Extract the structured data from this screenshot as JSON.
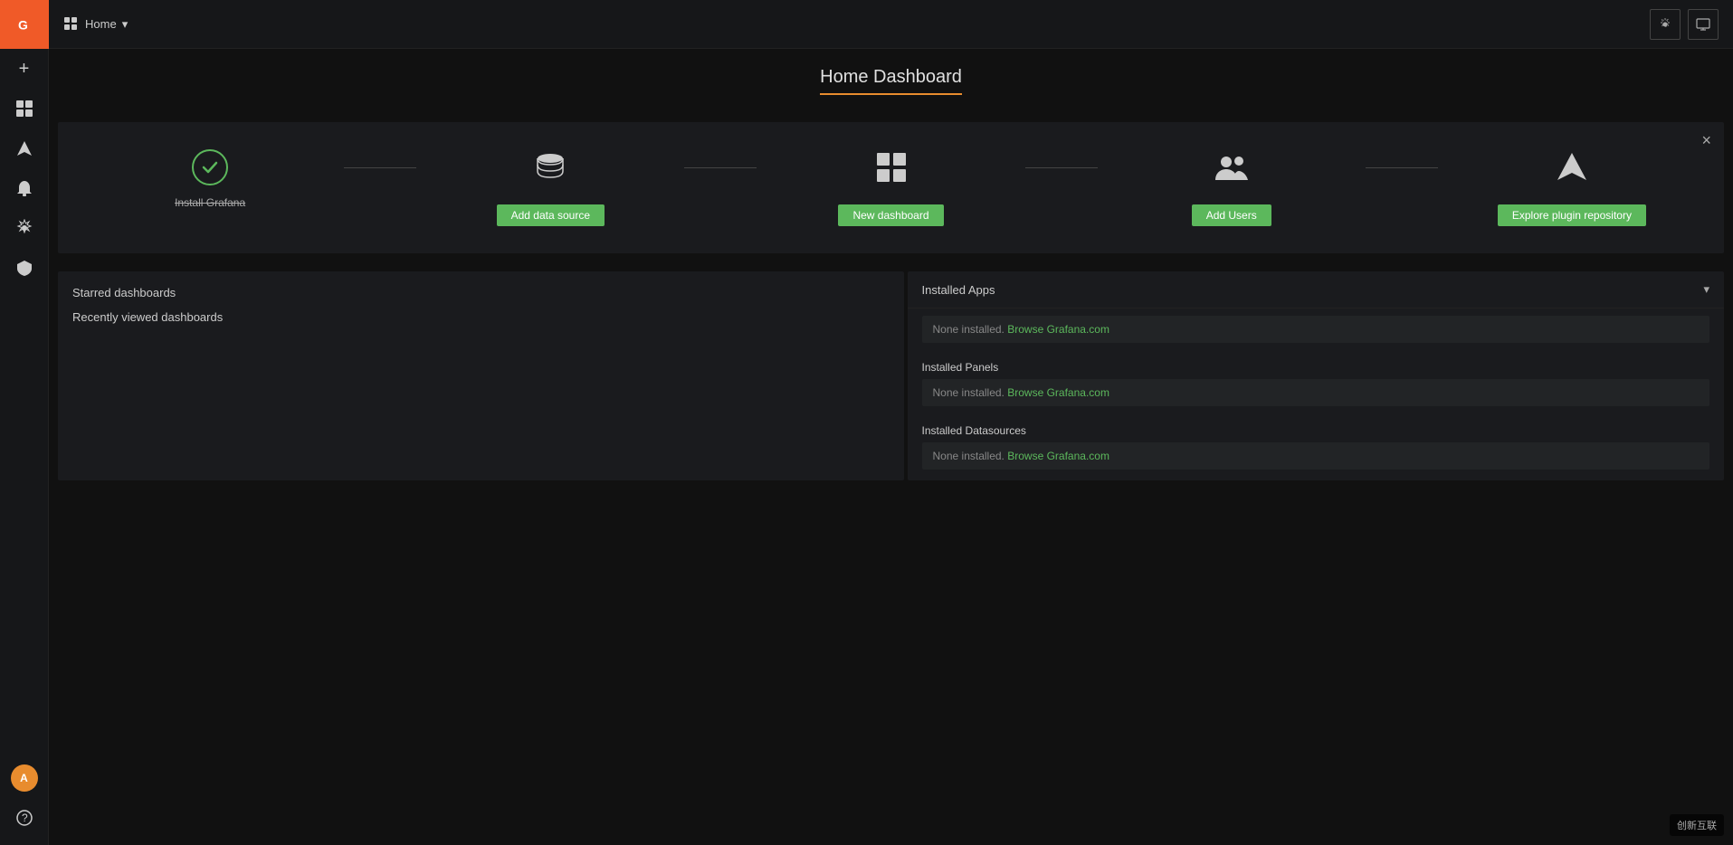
{
  "app": {
    "name": "Grafana"
  },
  "topnav": {
    "home_label": "Home",
    "dropdown_icon": "▾",
    "settings_icon": "⚙",
    "monitor_icon": "🖥"
  },
  "page": {
    "title": "Home Dashboard"
  },
  "getting_started": {
    "close_icon": "×",
    "steps": [
      {
        "id": "install-grafana",
        "icon_type": "check",
        "label": "Install Grafana",
        "is_done": true,
        "button_label": null
      },
      {
        "id": "add-data-source",
        "icon_type": "database",
        "label": null,
        "is_done": false,
        "button_label": "Add data source"
      },
      {
        "id": "new-dashboard",
        "icon_type": "dashboard",
        "label": null,
        "is_done": false,
        "button_label": "New dashboard"
      },
      {
        "id": "add-users",
        "icon_type": "users",
        "label": null,
        "is_done": false,
        "button_label": "Add Users"
      },
      {
        "id": "explore-plugins",
        "icon_type": "plugins",
        "label": null,
        "is_done": false,
        "button_label": "Explore plugin repository"
      }
    ]
  },
  "left_panel": {
    "starred_label": "Starred dashboards",
    "recent_label": "Recently viewed dashboards"
  },
  "right_panel": {
    "installed_apps": {
      "title": "Installed Apps",
      "none_installed_text": "None installed.",
      "browse_link_text": "Browse Grafana.com"
    },
    "installed_panels": {
      "title": "Installed Panels",
      "none_installed_text": "None installed.",
      "browse_link_text": "Browse Grafana.com"
    },
    "installed_datasources": {
      "title": "Installed Datasources",
      "none_installed_text": "None installed.",
      "browse_link_text": "Browse Grafana.com"
    }
  },
  "sidebar": {
    "items": [
      {
        "id": "add",
        "icon": "+",
        "label": "Create"
      },
      {
        "id": "dashboards",
        "icon": "⊞",
        "label": "Dashboards"
      },
      {
        "id": "explore",
        "icon": "✦",
        "label": "Explore"
      },
      {
        "id": "alerting",
        "icon": "🔔",
        "label": "Alerting"
      },
      {
        "id": "settings",
        "icon": "⚙",
        "label": "Configuration"
      },
      {
        "id": "shield",
        "icon": "🛡",
        "label": "Server Admin"
      }
    ],
    "bottom": {
      "avatar_initials": "A",
      "help_icon": "?"
    }
  },
  "watermark": {
    "text": "创新互联"
  }
}
